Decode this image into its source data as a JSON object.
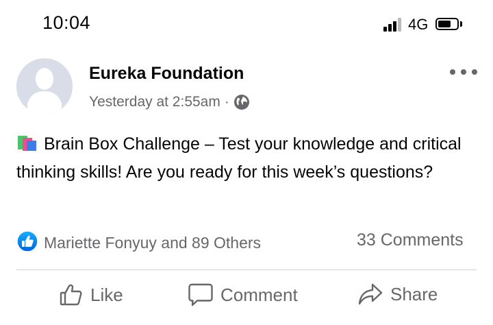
{
  "status_bar": {
    "time": "10:04",
    "network": "4G",
    "signal_icon": "cellular-signal-icon",
    "battery_icon": "battery-icon"
  },
  "post": {
    "page_name": "Eureka Foundation",
    "timestamp": "Yesterday at 2:55am",
    "separator": "·",
    "privacy_icon": "globe-icon",
    "menu_icon": "more-options-icon",
    "text_emoji_icon": "books-emoji-icon",
    "text": "Brain Box Challenge – Test your knowledge and critical thinking skills! Are you ready for this week’s questions?",
    "reactions": {
      "icon": "like-reaction-icon",
      "summary": "Mariette Fonyuy and 89 Others",
      "comments": "33 Comments"
    },
    "actions": {
      "like": "Like",
      "comment": "Comment",
      "share": "Share"
    }
  },
  "colors": {
    "text_primary": "#050505",
    "text_secondary": "#65676b",
    "brand_blue": "#1877f2",
    "divider": "#ced0d4"
  }
}
